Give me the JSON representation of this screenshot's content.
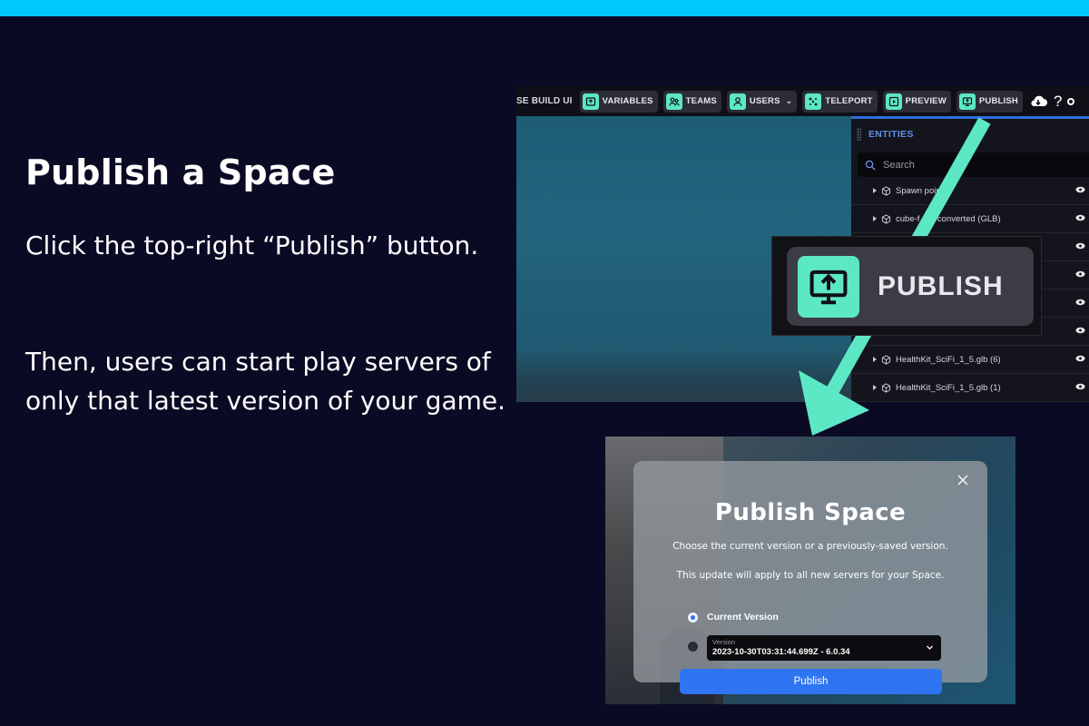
{
  "slide": {
    "title": "Publish a Space",
    "paragraph_1": "Click the top-right “Publish” button.",
    "paragraph_2": "Then, users can start play servers of only that latest version of your game."
  },
  "toolbar": {
    "cut_label": "SE BUILD UI",
    "buttons": [
      {
        "label": "VARIABLES",
        "icon": "variables-icon"
      },
      {
        "label": "TEAMS",
        "icon": "teams-icon"
      },
      {
        "label": "USERS",
        "icon": "users-icon"
      },
      {
        "label": "TELEPORT",
        "icon": "teleport-icon"
      },
      {
        "label": "PREVIEW",
        "icon": "play-icon"
      },
      {
        "label": "PUBLISH",
        "icon": "publish-icon"
      }
    ],
    "help_label": "?",
    "accent_color": "#5ce8c4"
  },
  "entities": {
    "title": "ENTITIES",
    "search_placeholder": "Search",
    "rows": [
      "Spawn point        d",
      "cube-f             are-converted (GLB)",
      "",
      "",
      "",
      "",
      "HealthKit_SciFi_1_5.glb (6)",
      "HealthKit_SciFi_1_5.glb (1)"
    ]
  },
  "zoom_callout": {
    "label": "PUBLISH"
  },
  "modal": {
    "title": "Publish Space",
    "subtitle_1": "Choose the current version or a previously-saved version.",
    "subtitle_2": "This update will apply to all new servers for your Space.",
    "option_current": "Current Version",
    "version_caption": "Version",
    "version_value": "2023-10-30T03:31:44.699Z - 6.0.34",
    "publish_button": "Publish"
  },
  "colors": {
    "background": "#0b0a24",
    "top_accent": "#00c8ff",
    "arrow": "#5ce8c4",
    "primary_button": "#2f74f0"
  }
}
